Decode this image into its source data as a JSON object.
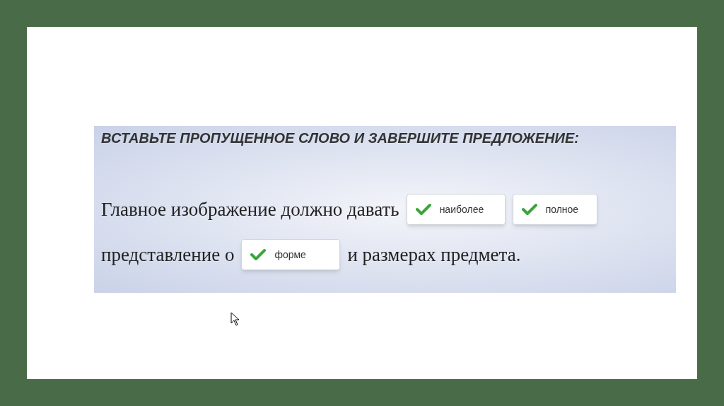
{
  "task": {
    "title": "ВСТАВЬТЕ ПРОПУЩЕННОЕ СЛОВО И ЗАВЕРШИТЕ ПРЕДЛОЖЕНИЕ:",
    "lines": [
      {
        "segments": [
          {
            "kind": "text",
            "text": "Главное изображение должно давать"
          },
          {
            "kind": "blank",
            "answer": "наиболее",
            "correct": true
          },
          {
            "kind": "blank",
            "answer": "полное",
            "correct": true
          }
        ]
      },
      {
        "segments": [
          {
            "kind": "text",
            "text": "представление о"
          },
          {
            "kind": "blank",
            "answer": "форме",
            "correct": true
          },
          {
            "kind": "text",
            "text": "и размерах предмета."
          }
        ]
      }
    ]
  }
}
